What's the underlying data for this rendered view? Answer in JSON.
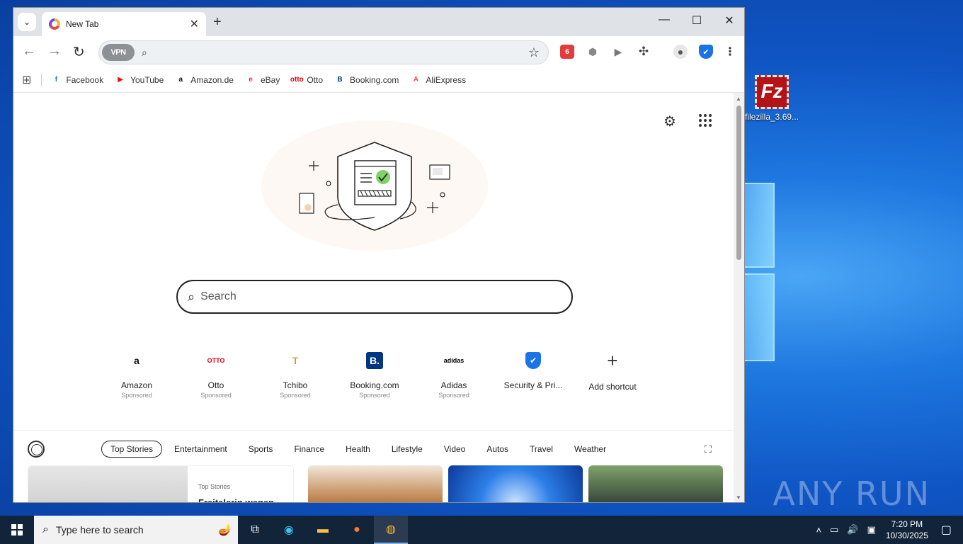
{
  "desktop": {
    "icon_label": "filezilla_3.69...",
    "icon_glyph": "Fz",
    "watermark": "ANY RUN"
  },
  "browser": {
    "tab_title": "New Tab",
    "vpn_label": "VPN",
    "omnibox_value": "",
    "bookmarks": [
      {
        "label": "Facebook",
        "icon": "facebook-icon",
        "color": "#1877f2",
        "glyph": "f"
      },
      {
        "label": "YouTube",
        "icon": "youtube-icon",
        "color": "#ff0000",
        "glyph": "▶"
      },
      {
        "label": "Amazon.de",
        "icon": "amazon-icon",
        "color": "#111111",
        "glyph": "a"
      },
      {
        "label": "eBay",
        "icon": "ebay-icon",
        "color": "#e53238",
        "glyph": "e"
      },
      {
        "label": "Otto",
        "icon": "otto-icon",
        "color": "#e3000f",
        "glyph": "otto"
      },
      {
        "label": "Booking.com",
        "icon": "booking-icon",
        "color": "#003580",
        "glyph": "B"
      },
      {
        "label": "AliExpress",
        "icon": "aliexpress-icon",
        "color": "#ff4747",
        "glyph": "A"
      }
    ]
  },
  "newtab": {
    "search_placeholder": "Search",
    "shortcuts": [
      {
        "name": "Amazon",
        "sub": "Sponsored",
        "glyph": "a",
        "color": "#111111"
      },
      {
        "name": "Otto",
        "sub": "Sponsored",
        "glyph": "OTTO",
        "color": "#e3000f"
      },
      {
        "name": "Tchibo",
        "sub": "Sponsored",
        "glyph": "T",
        "color": "#c8a24a"
      },
      {
        "name": "Booking.com",
        "sub": "Sponsored",
        "glyph": "B.",
        "color": "#003580"
      },
      {
        "name": "Adidas",
        "sub": "Sponsored",
        "glyph": "adidas",
        "color": "#000000"
      },
      {
        "name": "Security & Pri...",
        "sub": "",
        "glyph": "✔",
        "color": "#1a73e8"
      },
      {
        "name": "Add shortcut",
        "sub": "",
        "glyph": "+",
        "color": "#333333"
      }
    ],
    "feed_tabs": [
      "Top Stories",
      "Entertainment",
      "Sports",
      "Finance",
      "Health",
      "Lifestyle",
      "Video",
      "Autos",
      "Travel",
      "Weather"
    ],
    "active_feed_tab": "Top Stories",
    "news_tag": "Top Stories",
    "news_title": "Freitalerin wegen"
  },
  "taskbar": {
    "search_placeholder": "Type here to search",
    "time": "7:20 PM",
    "date": "10/30/2025"
  }
}
